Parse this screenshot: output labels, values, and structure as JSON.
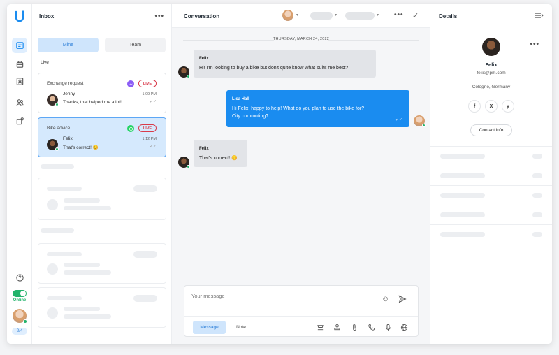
{
  "inbox": {
    "title": "Inbox",
    "tabs": {
      "mine": "Mine",
      "team": "Team"
    },
    "section_live": "Live",
    "conversations": [
      {
        "topic": "Exchange request",
        "channel": "messenger-icon",
        "badge": "LIVE",
        "name": "Jenny",
        "preview": "Thanks, that helped me a lot!",
        "time": "1:09 PM",
        "ticks": "✓✓"
      },
      {
        "topic": "Bike advice",
        "channel": "whatsapp-icon",
        "badge": "LIVE",
        "name": "Felix",
        "preview": "That's correct! 😊",
        "time": "1:12 PM",
        "ticks": "✓✓"
      }
    ]
  },
  "rail": {
    "status": "Online",
    "count": "2/4"
  },
  "conversation": {
    "title": "Conversation",
    "date": "THURSDAY, MARCH 24, 2022",
    "messages": [
      {
        "sender": "Felix",
        "text": "Hi! I'm looking to buy a bike but don't quite know what suits me best?"
      },
      {
        "sender": "Lisa Hall",
        "text1": "Hi Felix, happy to help! What do you plan to use the bike for?",
        "text2": "City commuting?",
        "ticks": "✓✓"
      },
      {
        "sender": "Felix",
        "text": "That's correct! 😊"
      }
    ],
    "composer": {
      "placeholder": "Your message",
      "message_tab": "Message",
      "note_tab": "Note"
    }
  },
  "details": {
    "title": "Details",
    "name": "Felix",
    "email": "felix@pm.com",
    "location": "Cologne, Germany",
    "socials": [
      "f",
      "X",
      "y"
    ],
    "contact_button": "Contact info"
  },
  "colors": {
    "accent": "#1a8cf0",
    "online": "#22b36b",
    "live": "#d93b4b"
  }
}
